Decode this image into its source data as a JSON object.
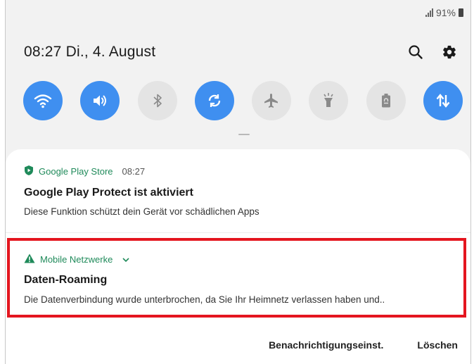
{
  "status_bar": {
    "battery_text": "91%",
    "signal_icon": "signal-icon",
    "battery_icon": "battery-icon"
  },
  "header": {
    "datetime": "08:27  Di., 4. August",
    "search_icon": "search-icon",
    "settings_icon": "gear-icon"
  },
  "quick_settings": [
    {
      "name": "wifi",
      "icon": "wifi-icon",
      "state": "on"
    },
    {
      "name": "sound",
      "icon": "volume-icon",
      "state": "on"
    },
    {
      "name": "bluetooth",
      "icon": "bluetooth-icon",
      "state": "off"
    },
    {
      "name": "auto-rotate",
      "icon": "rotate-icon",
      "state": "on"
    },
    {
      "name": "airplane-mode",
      "icon": "airplane-icon",
      "state": "off"
    },
    {
      "name": "flashlight",
      "icon": "flashlight-icon",
      "state": "off"
    },
    {
      "name": "power-saving",
      "icon": "battery-saver-icon",
      "state": "off"
    },
    {
      "name": "mobile-data",
      "icon": "data-transfer-icon",
      "state": "on"
    }
  ],
  "colors": {
    "accent": "#3f8ff0",
    "app_green": "#1f8a5a",
    "highlight_red": "#e4161f"
  },
  "notifications": [
    {
      "app": "Google Play Store",
      "time": "08:27",
      "title": "Google Play Protect ist aktiviert",
      "body": "Diese Funktion schützt dein Gerät vor schädlichen Apps"
    },
    {
      "app": "Mobile Netzwerke",
      "title": "Daten-Roaming",
      "body": "Die Datenverbindung wurde unterbrochen, da Sie Ihr Heimnetz verlassen haben und.."
    }
  ],
  "actions": {
    "settings_label": "Benachrichtigungseinst.",
    "clear_label": "Löschen"
  }
}
